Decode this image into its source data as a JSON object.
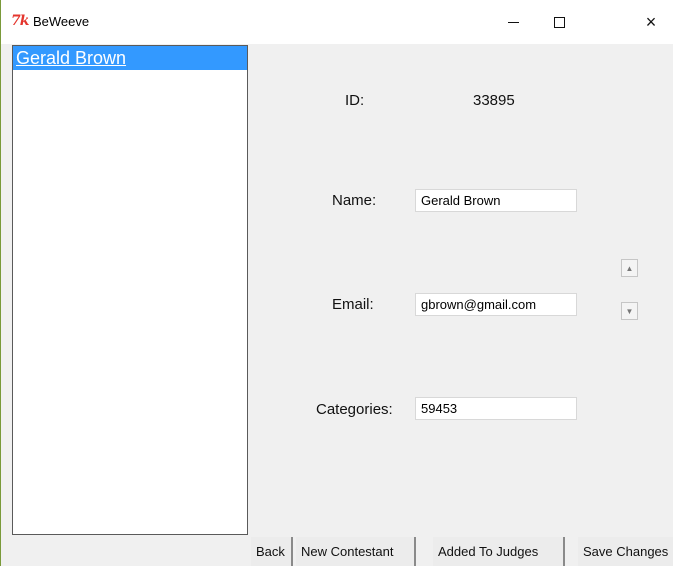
{
  "window": {
    "logo": "7k",
    "title": "BeWeeve",
    "controls": {
      "minimize": "minimize",
      "maximize": "maximize",
      "close": "×"
    }
  },
  "list": {
    "items": [
      {
        "label": "Gerald Brown",
        "selected": true
      }
    ]
  },
  "details": {
    "id_label": "ID:",
    "id_value": "33895",
    "name_label": "Name:",
    "name_value": "Gerald Brown",
    "email_label": "Email:",
    "email_value": "gbrown@gmail.com",
    "categories_label": "Categories:",
    "categories_value": "59453"
  },
  "scroll": {
    "up_icon": "▲",
    "down_icon": "▼"
  },
  "buttons": {
    "back": "Back",
    "new_contestant": "New Contestant",
    "added_to_judges": "Added To Judges",
    "save_changes": "Save Changes"
  },
  "colors": {
    "selection": "#3399ff",
    "logo": "#e4352d",
    "background": "#f0f0f0"
  }
}
